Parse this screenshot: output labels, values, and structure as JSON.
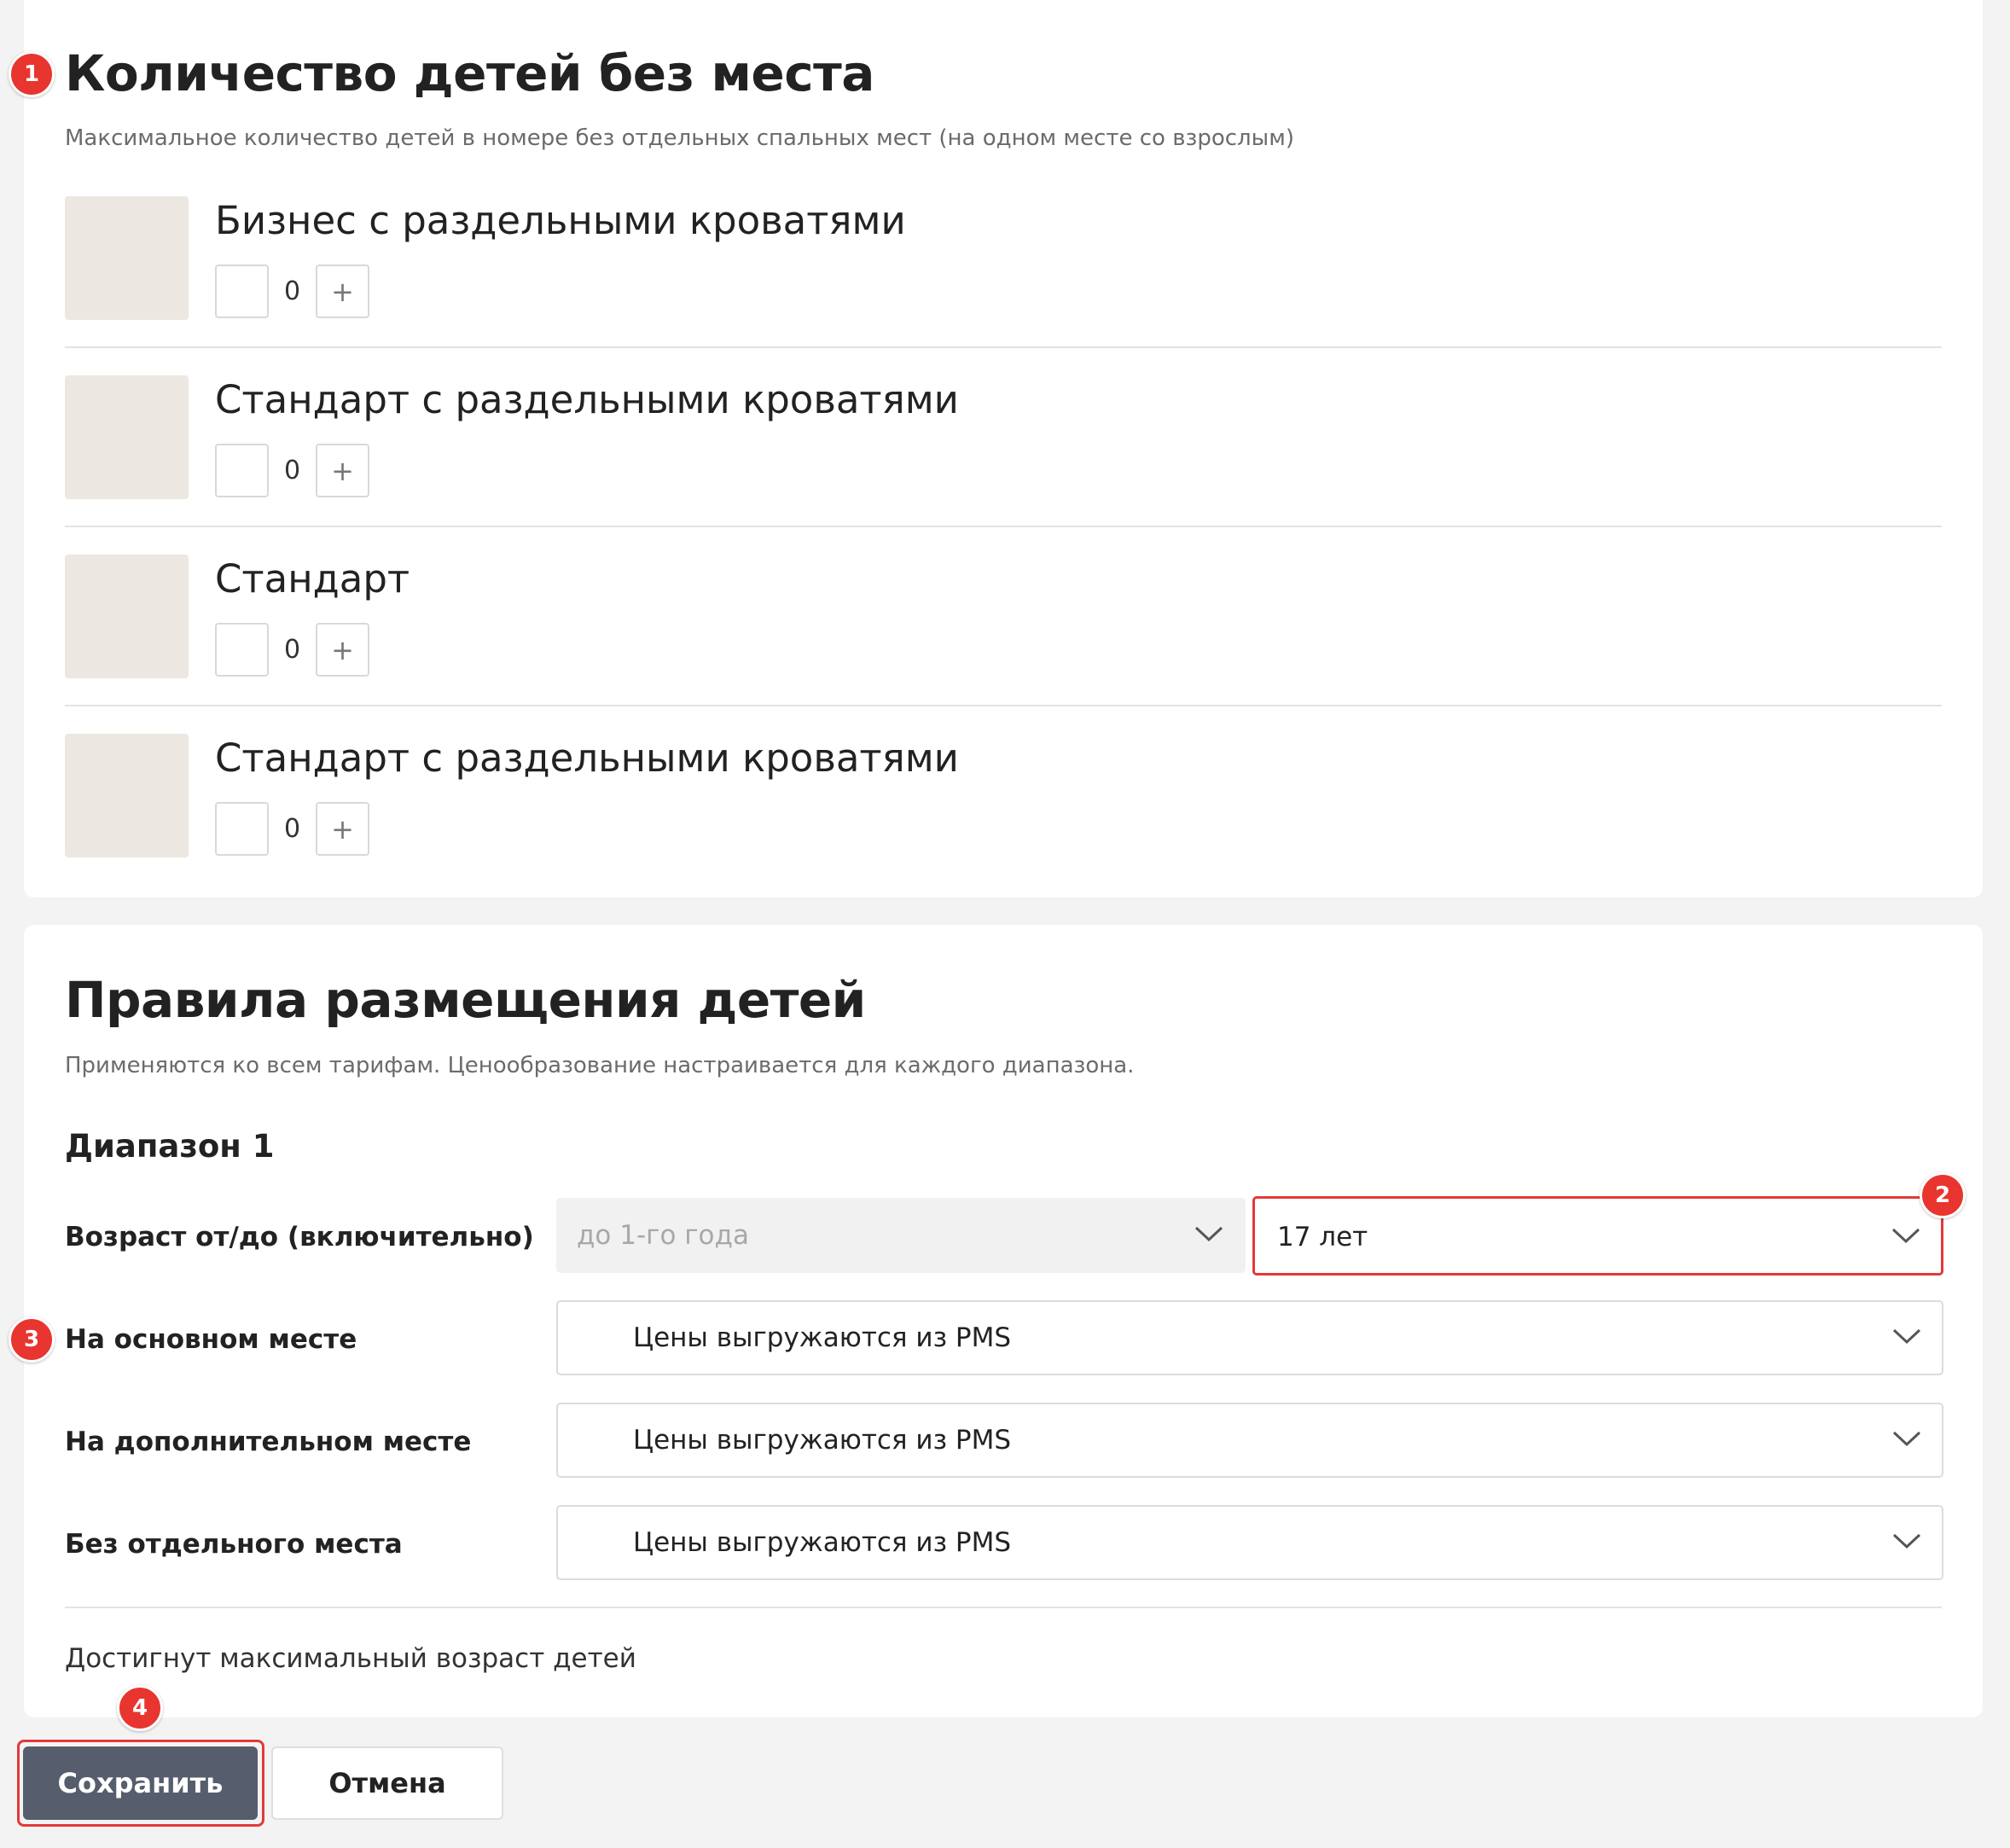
{
  "section1": {
    "title": "Количество детей без места",
    "subtitle": "Максимальное количество детей в номере без отдельных спальных мест (на одном месте со взрослым)",
    "rooms": [
      {
        "name": "Бизнес с раздельными кроватями",
        "count": "0",
        "minus": "",
        "plus": "+"
      },
      {
        "name": "Стандарт с раздельными кроватями",
        "count": "0",
        "minus": "",
        "plus": "+"
      },
      {
        "name": "Стандарт",
        "count": "0",
        "minus": "",
        "plus": "+"
      },
      {
        "name": "Стандарт с раздельными кроватями",
        "count": "0",
        "minus": "",
        "plus": "+"
      }
    ]
  },
  "section2": {
    "title": "Правила размещения детей",
    "subtitle": "Применяются ко всем тарифам. Ценообразование настраивается для каждого диапазона.",
    "range_title": "Диапазон 1",
    "age_label": "Возраст от/до (включительно)",
    "age_from": "до 1-го года",
    "age_to": "17 лет",
    "main_place_label": "На основном месте",
    "main_place_value": "Цены выгружаются из PMS",
    "extra_place_label": "На дополнительном месте",
    "extra_place_value": "Цены выгружаются из PMS",
    "no_place_label": "Без отдельного места",
    "no_place_value": "Цены выгружаются из PMS",
    "note": "Достигнут максимальный возраст детей"
  },
  "actions": {
    "save": "Сохранить",
    "cancel": "Отмена"
  },
  "badges": [
    "1",
    "2",
    "3",
    "4"
  ],
  "colors": {
    "badge": "#e9352f",
    "highlight": "#e23a3a",
    "save_button": "#565d6c",
    "thumbnail": "#ece7e0",
    "page_bg": "#f3f3f3"
  }
}
